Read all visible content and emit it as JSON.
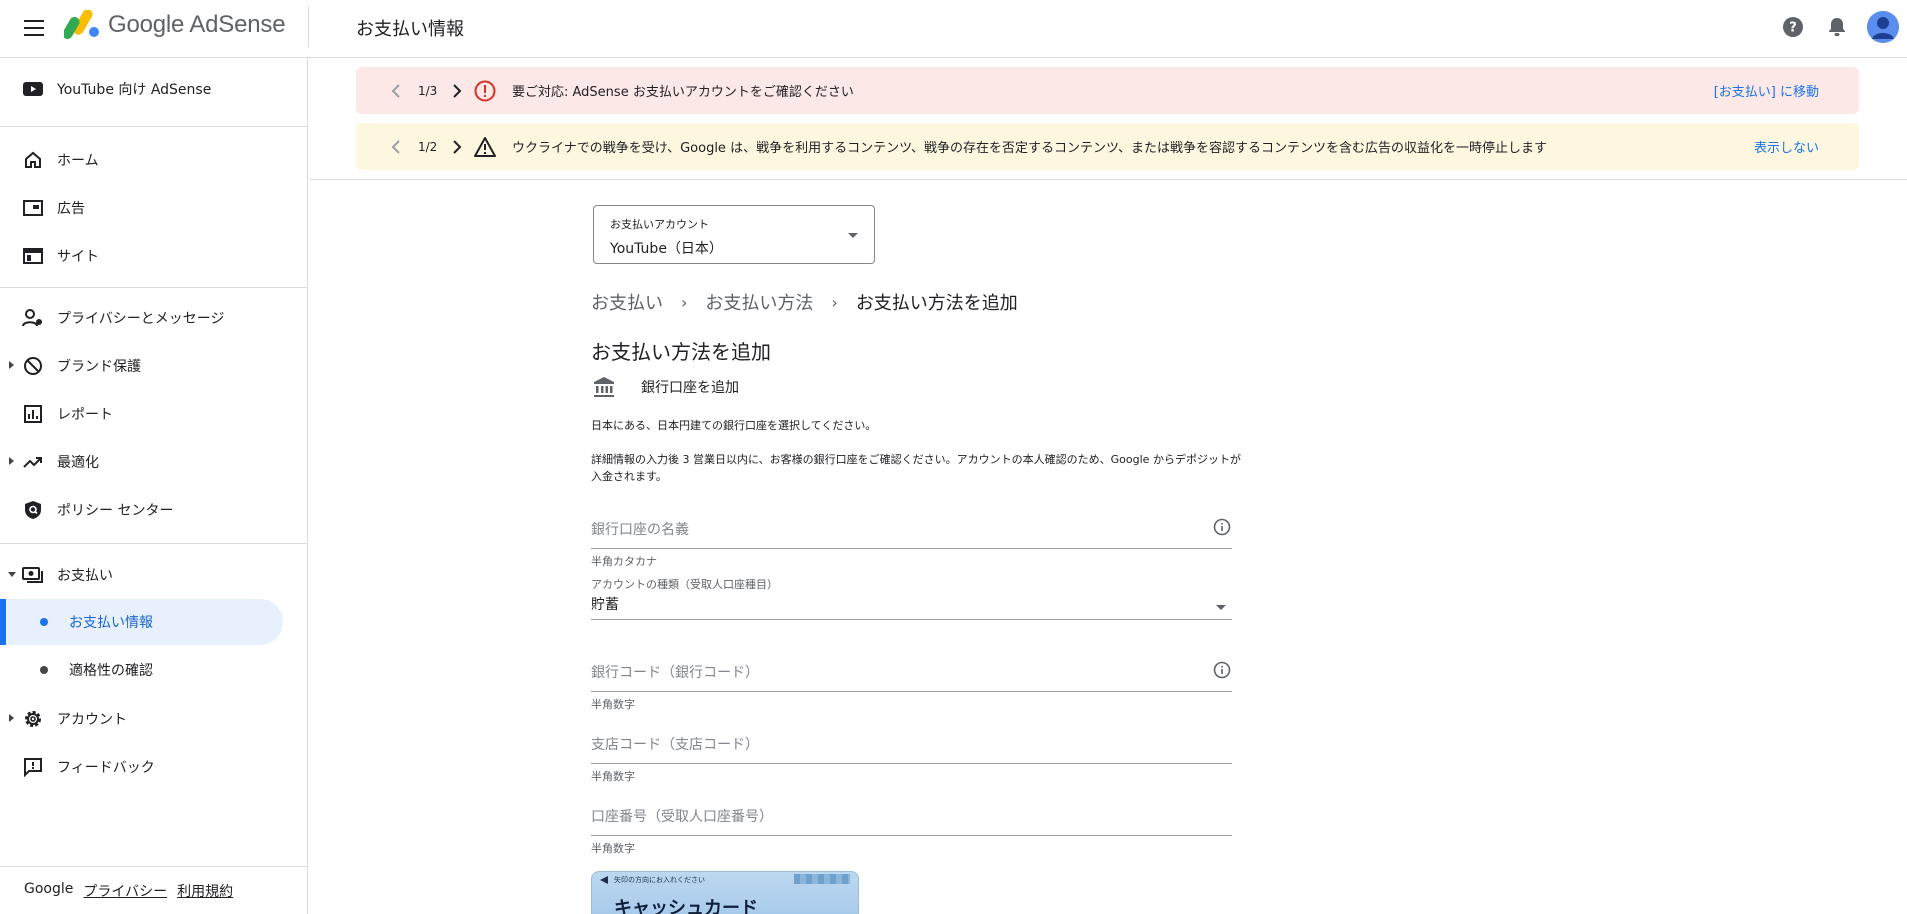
{
  "header": {
    "app_name": "Google AdSense",
    "page_title": "お支払い情報"
  },
  "sidebar": {
    "youtube": "YouTube 向け AdSense",
    "items": {
      "home": "ホーム",
      "ads": "広告",
      "sites": "サイト",
      "privacy": "プライバシーとメッセージ",
      "brand": "ブランド保護",
      "reports": "レポート",
      "optimize": "最適化",
      "policy": "ポリシー センター",
      "payments": "お支払い",
      "payment_info": "お支払い情報",
      "eligibility": "適格性の確認",
      "account": "アカウント",
      "feedback": "フィードバック"
    },
    "footer": {
      "google": "Google",
      "privacy": "プライバシー",
      "terms": "利用規約"
    }
  },
  "banners": {
    "error": {
      "count": "1/3",
      "text": "要ご対応: AdSense お支払いアカウントをご確認ください",
      "action": "[お支払い] に移動"
    },
    "warning": {
      "count": "1/2",
      "text": "ウクライナでの戦争を受け、Google は、戦争を利用するコンテンツ、戦争の存在を否定するコンテンツ、または戦争を容認するコンテンツを含む広告の収益化を一時停止します",
      "action": "表示しない"
    }
  },
  "content": {
    "account_select": {
      "caption": "お支払いアカウント",
      "value": "YouTube（日本）"
    },
    "breadcrumb": [
      "お支払い",
      "お支払い方法",
      "お支払い方法を追加"
    ],
    "heading": "お支払い方法を追加",
    "bank_label": "銀行口座を追加",
    "para1": "日本にある、日本円建ての銀行口座を選択してください。",
    "para2": "詳細情報の入力後 3 営業日以内に、お客様の銀行口座をご確認ください。アカウントの本人確認のため、Google からデポジットが入金されます。",
    "fields": {
      "account_name": {
        "placeholder": "銀行口座の名義",
        "hint": "半角カタカナ"
      },
      "account_type": {
        "caption": "アカウントの種類（受取人口座種目）",
        "value": "貯蓄"
      },
      "bank_code": {
        "placeholder": "銀行コード（銀行コード）",
        "hint": "半角数字"
      },
      "branch_code": {
        "placeholder": "支店コード（支店コード）",
        "hint": "半角数字"
      },
      "account_number": {
        "placeholder": "口座番号（受取人口座番号）",
        "hint": "半角数字"
      }
    },
    "card_image": {
      "note": "矢印の方向にお入れください",
      "title": "キャッシュカード"
    }
  },
  "colors": {
    "accent": "#1a73e8",
    "error_bg": "#fce8e6",
    "error_icon": "#d93025",
    "warn_bg": "#fef7e0",
    "active_nav_bg": "#e8f0fe"
  }
}
